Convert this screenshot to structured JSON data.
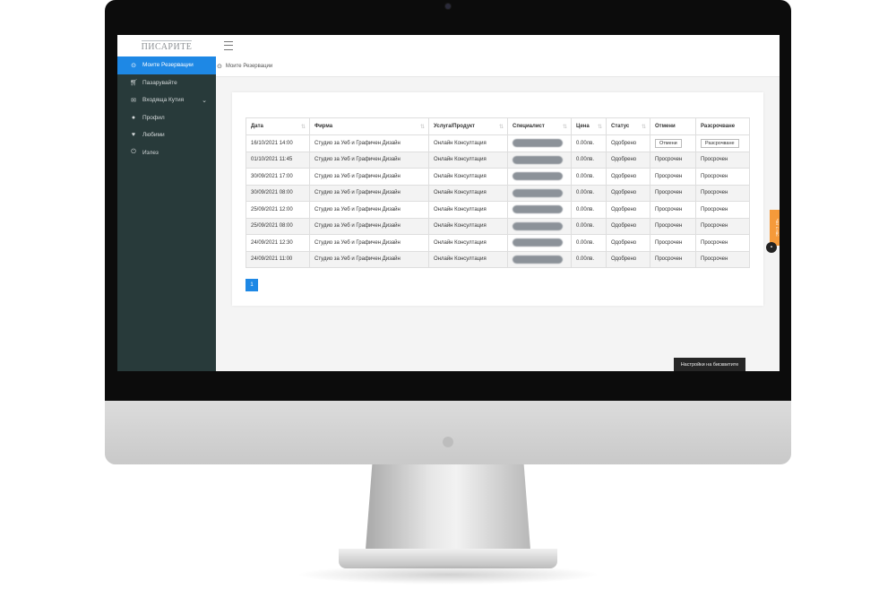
{
  "brand": {
    "logo_text": "ПИСАРИТЕ"
  },
  "sidebar": {
    "items": [
      {
        "label": "Моите Резервации",
        "icon": "clock-icon"
      },
      {
        "label": "Пазарувайте",
        "icon": "cart-icon"
      },
      {
        "label": "Входяща Кутия",
        "icon": "envelope-icon"
      },
      {
        "label": "Профил",
        "icon": "user-icon"
      },
      {
        "label": "Любими",
        "icon": "heart-icon"
      },
      {
        "label": "Излез",
        "icon": "power-icon"
      }
    ]
  },
  "breadcrumb": {
    "label": "Моите Резервации"
  },
  "table": {
    "headers": [
      "Дата",
      "Фирма",
      "Услуга/Продукт",
      "Специалист",
      "Цена",
      "Статус",
      "Отмени",
      "Разсрочване"
    ],
    "rows": [
      {
        "date": "16/10/2021 14:00",
        "company": "Студио за Уеб и Графичен Дизайн",
        "service": "Онлайн Консултация",
        "price": "0.00лв.",
        "status": "Одобрено",
        "cancel": "Отмени",
        "defer": "Разсрочване"
      },
      {
        "date": "01/10/2021 11:45",
        "company": "Студио за Уеб и Графичен Дизайн",
        "service": "Онлайн Консултация",
        "price": "0.00лв.",
        "status": "Одобрено",
        "cancel": "Просрочен",
        "defer": "Просрочен"
      },
      {
        "date": "30/09/2021 17:00",
        "company": "Студио за Уеб и Графичен Дизайн",
        "service": "Онлайн Консултация",
        "price": "0.00лв.",
        "status": "Одобрено",
        "cancel": "Просрочен",
        "defer": "Просрочен"
      },
      {
        "date": "30/09/2021 08:00",
        "company": "Студио за Уеб и Графичен Дизайн",
        "service": "Онлайн Консултация",
        "price": "0.00лв.",
        "status": "Одобрено",
        "cancel": "Просрочен",
        "defer": "Просрочен"
      },
      {
        "date": "25/09/2021 12:00",
        "company": "Студио за Уеб и Графичен Дизайн",
        "service": "Онлайн Консултация",
        "price": "0.00лв.",
        "status": "Одобрено",
        "cancel": "Просрочен",
        "defer": "Просрочен"
      },
      {
        "date": "25/09/2021 08:00",
        "company": "Студио за Уеб и Графичен Дизайн",
        "service": "Онлайн Консултация",
        "price": "0.00лв.",
        "status": "Одобрено",
        "cancel": "Просрочен",
        "defer": "Просрочен"
      },
      {
        "date": "24/09/2021 12:30",
        "company": "Студио за Уеб и Графичен Дизайн",
        "service": "Онлайн Консултация",
        "price": "0.00лв.",
        "status": "Одобрено",
        "cancel": "Просрочен",
        "defer": "Просрочен"
      },
      {
        "date": "24/09/2021 11:00",
        "company": "Студио за Уеб и Графичен Дизайн",
        "service": "Онлайн Консултация",
        "price": "0.00лв.",
        "status": "Одобрено",
        "cancel": "Просрочен",
        "defer": "Просрочен"
      }
    ]
  },
  "pagination": {
    "current": "1"
  },
  "cookie_bar": {
    "label": "Настройки на бисквитите"
  },
  "chat": {
    "tab_label": "Чат с нас"
  },
  "colors": {
    "sidebar_bg": "#283a3a",
    "accent": "#1e88e5",
    "chat_tab": "#f59a3a"
  }
}
